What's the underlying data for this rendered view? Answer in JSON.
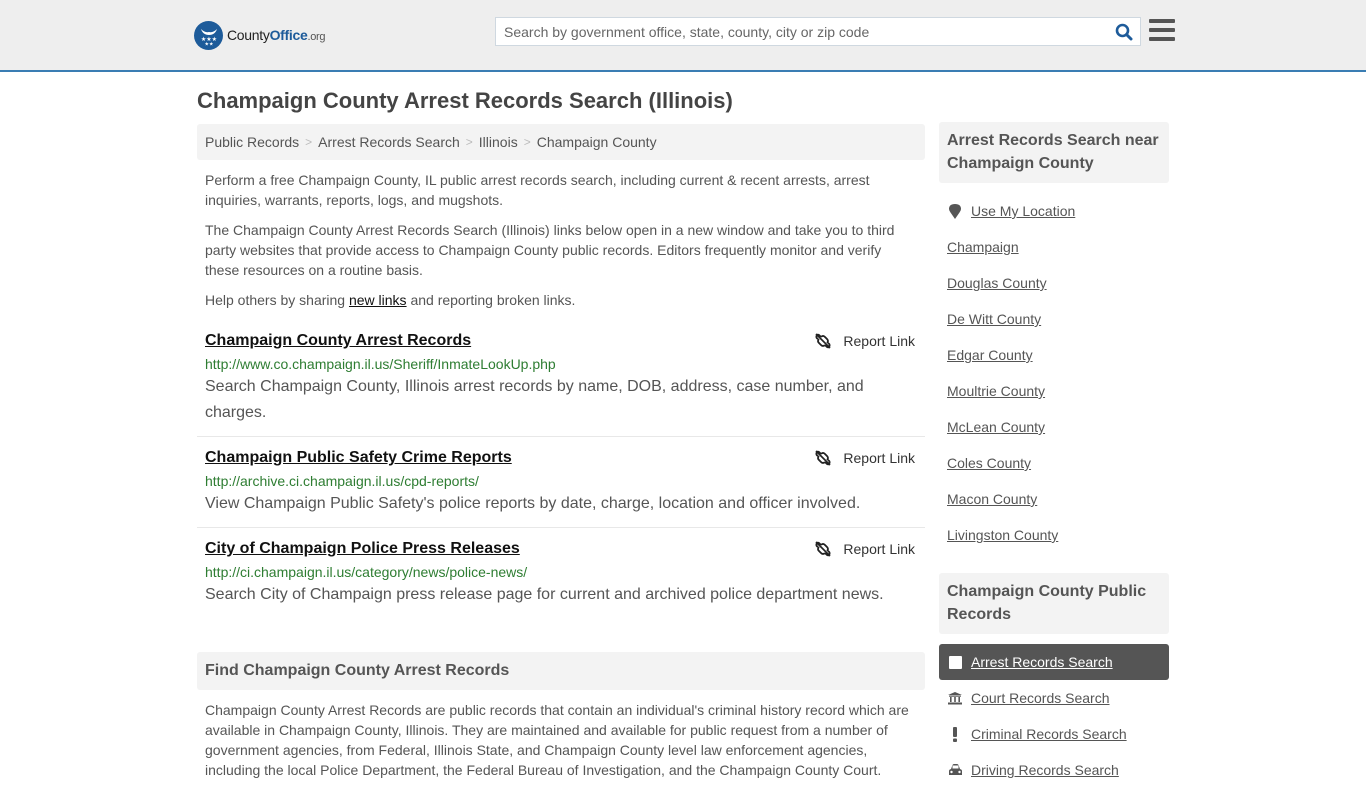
{
  "header": {
    "logo": {
      "name": "County",
      "office": "Office",
      "tld": ".org"
    },
    "search": {
      "placeholder": "Search by government office, state, county, city or zip code",
      "value": ""
    },
    "colors": {
      "brand": "#1d5b9a",
      "accent_border": "#3a7db3"
    }
  },
  "page": {
    "title": "Champaign County Arrest Records Search (Illinois)"
  },
  "breadcrumb": [
    {
      "label": "Public Records"
    },
    {
      "label": "Arrest Records Search"
    },
    {
      "label": "Illinois"
    },
    {
      "label": "Champaign County"
    }
  ],
  "intro": {
    "p1": "Perform a free Champaign County, IL public arrest records search, including current & recent arrests, arrest inquiries, warrants, reports, logs, and mugshots.",
    "p2": "The Champaign County Arrest Records Search (Illinois) links below open in a new window and take you to third party websites that provide access to Champaign County public records. Editors frequently monitor and verify these resources on a routine basis.",
    "p3_before": "Help others by sharing ",
    "p3_link": "new links",
    "p3_after": " and reporting broken links."
  },
  "links": [
    {
      "title": "Champaign County Arrest Records",
      "url": "http://www.co.champaign.il.us/Sheriff/InmateLookUp.php",
      "description": "Search Champaign County, Illinois arrest records by name, DOB, address, case number, and charges.",
      "report_label": "Report Link"
    },
    {
      "title": "Champaign Public Safety Crime Reports",
      "url": "http://archive.ci.champaign.il.us/cpd-reports/",
      "description": "View Champaign Public Safety's police reports by date, charge, location and officer involved.",
      "report_label": "Report Link"
    },
    {
      "title": "City of Champaign Police Press Releases",
      "url": "http://ci.champaign.il.us/category/news/police-news/",
      "description": "Search City of Champaign press release page for current and archived police department news.",
      "report_label": "Report Link"
    }
  ],
  "find_section": {
    "heading": "Find Champaign County Arrest Records",
    "body": "Champaign County Arrest Records are public records that contain an individual's criminal history record which are available in Champaign County, Illinois. They are maintained and available for public request from a number of government agencies, from Federal, Illinois State, and Champaign County level law enforcement agencies, including the local Police Department, the Federal Bureau of Investigation, and the Champaign County Court."
  },
  "sidebar": {
    "nearby": {
      "heading": "Arrest Records Search near Champaign County",
      "use_location": "Use My Location",
      "items": [
        "Champaign",
        "Douglas County",
        "De Witt County",
        "Edgar County",
        "Moultrie County",
        "McLean County",
        "Coles County",
        "Macon County",
        "Livingston County"
      ]
    },
    "public_records": {
      "heading": "Champaign County Public Records",
      "items": [
        {
          "label": "Arrest Records Search",
          "icon": "square-icon",
          "active": true
        },
        {
          "label": "Court Records Search",
          "icon": "courthouse-icon",
          "active": false
        },
        {
          "label": "Criminal Records Search",
          "icon": "exclamation-icon",
          "active": false
        },
        {
          "label": "Driving Records Search",
          "icon": "car-icon",
          "active": false
        }
      ]
    }
  }
}
